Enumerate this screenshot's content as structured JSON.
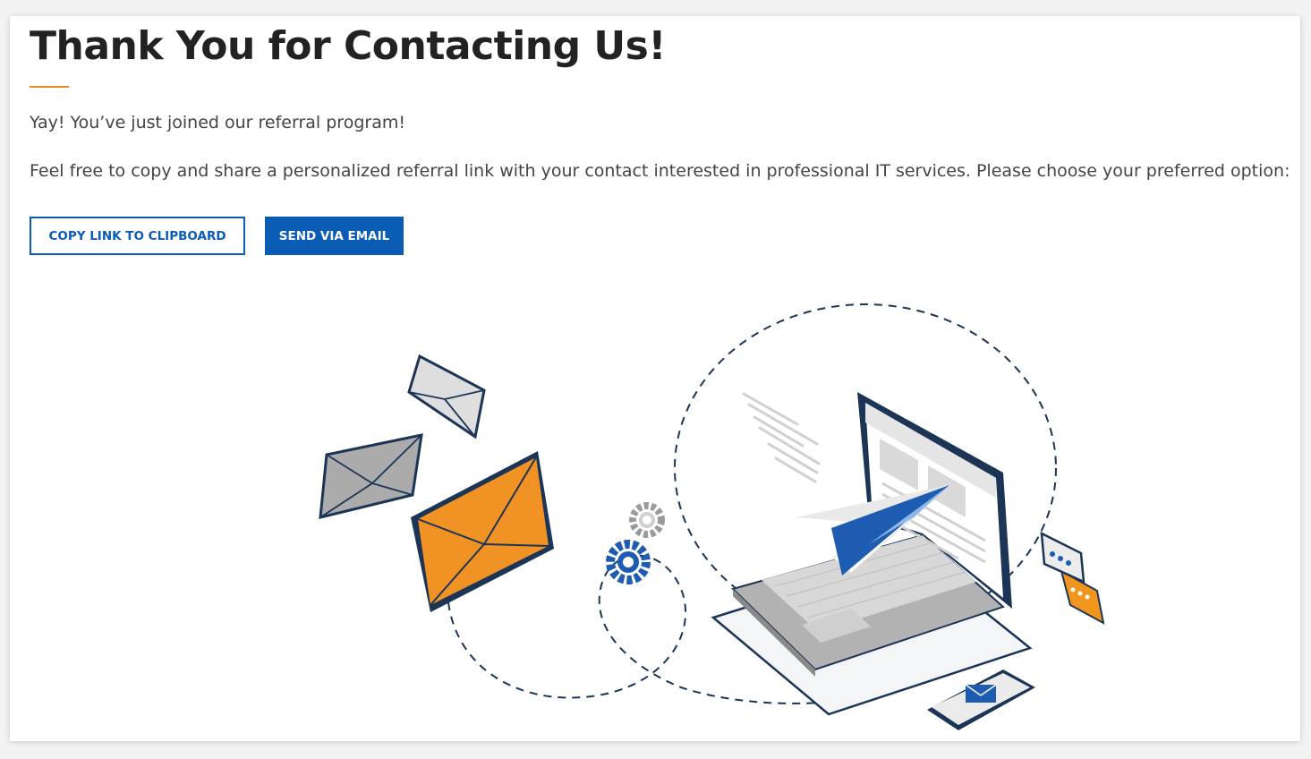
{
  "page": {
    "title": "Thank You for Contacting Us!",
    "message_1": "Yay! You’ve just joined our referral program!",
    "message_2": "Feel free to copy and share a personalized referral link with your contact interested in professional IT services. Please choose your preferred option:"
  },
  "actions": {
    "copy_link_label": "COPY LINK TO CLIPBOARD",
    "send_email_label": "SEND VIA EMAIL"
  },
  "colors": {
    "accent": "#e88a1d",
    "primary": "#0a5cb5",
    "navy": "#15325e"
  },
  "illustration": {
    "icons": [
      "envelope-icon",
      "gear-icon",
      "laptop-icon",
      "paper-plane-icon",
      "phone-icon",
      "chat-bubble-icon"
    ]
  }
}
